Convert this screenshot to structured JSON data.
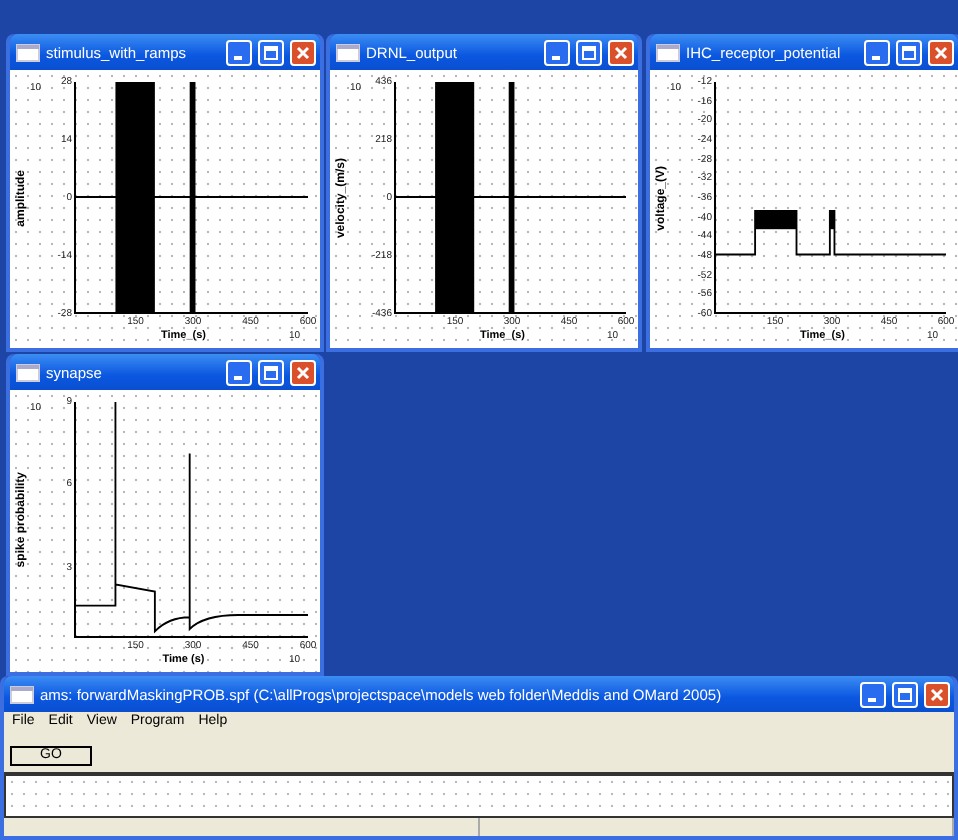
{
  "plot_windows": [
    {
      "title": "stimulus_with_ramps",
      "kind": "bursts",
      "ylabel": "amplitude",
      "yscale": "10",
      "yticks": [
        "28",
        "14",
        "0",
        "-14",
        "-28"
      ],
      "xticks": [
        "150",
        "300",
        "450",
        "600"
      ],
      "xlabel": "Time_(s)",
      "xscale": "10"
    },
    {
      "title": "DRNL_output",
      "kind": "bursts",
      "ylabel": "velocity_(m/s)",
      "yscale": "10",
      "yticks": [
        "436",
        "218",
        "0",
        "-218",
        "-436"
      ],
      "xticks": [
        "150",
        "300",
        "450",
        "600"
      ],
      "xlabel": "Time_(s)",
      "xscale": "10"
    },
    {
      "title": "IHC_receptor_potential",
      "kind": "receptor",
      "ylabel": "voltage_(V)",
      "yscale": "10",
      "yticks": [
        "-12",
        "-16",
        "-20",
        "-24",
        "-28",
        "-32",
        "-36",
        "-40",
        "-44",
        "-48",
        "-52",
        "-56",
        "-60"
      ],
      "xticks": [
        "150",
        "300",
        "450",
        "600"
      ],
      "xlabel": "Time_(s)",
      "xscale": "10"
    },
    {
      "title": "synapse",
      "kind": "synapse",
      "ylabel": "spike probability",
      "yscale": "10",
      "yticks": [
        "9",
        "6",
        "3"
      ],
      "xticks": [
        "150",
        "300",
        "450",
        "600"
      ],
      "xlabel": "Time (s)",
      "xscale": "10"
    }
  ],
  "main_window": {
    "title": "ams: forwardMaskingPROB.spf (C:\\allProgs\\projectspace\\models web folder\\Meddis and OMard 2005)",
    "menu": [
      "File",
      "Edit",
      "View",
      "Program",
      "Help"
    ],
    "button": "GO"
  }
}
